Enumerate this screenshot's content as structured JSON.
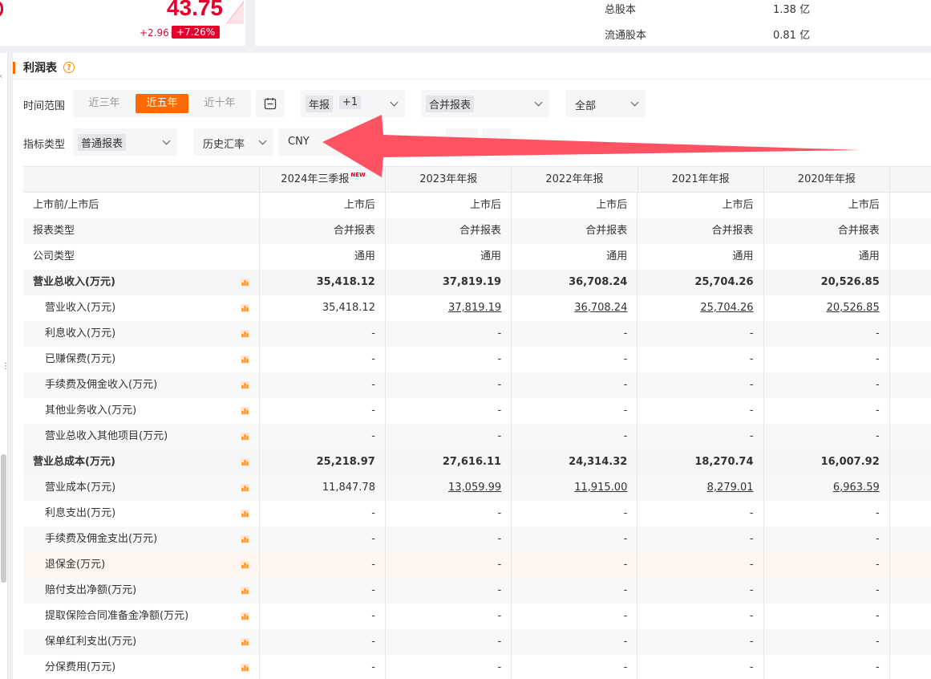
{
  "quote": {
    "price": "43.75",
    "change": "+2.96",
    "change_pct": "+7.26%",
    "stats": [
      {
        "label": "总股本",
        "value": "1.38 亿"
      },
      {
        "label": "流通股本",
        "value": "0.81 亿"
      }
    ]
  },
  "section": {
    "title": "利润表",
    "help": "?"
  },
  "filters": {
    "time_range_label": "时间范围",
    "time_range_options": [
      "近三年",
      "近五年",
      "近十年"
    ],
    "time_range_selected": "近五年",
    "report_period": {
      "value": "年报",
      "extra": "+1"
    },
    "report_type": "合并报表",
    "scope": "全部",
    "indicator_type_label": "指标类型",
    "indicator_type": "普通报表",
    "exchange_rate": "历史汇率",
    "currency": "CNY"
  },
  "table": {
    "columns": [
      "2024年三季报",
      "2023年年报",
      "2022年年报",
      "2021年年报",
      "2020年年报"
    ],
    "new_badge": "NEW",
    "rows": [
      {
        "name": "上市前/上市后",
        "values": [
          "上市后",
          "上市后",
          "上市后",
          "上市后",
          "上市后"
        ]
      },
      {
        "name": "报表类型",
        "values": [
          "合并报表",
          "合并报表",
          "合并报表",
          "合并报表",
          "合并报表"
        ]
      },
      {
        "name": "公司类型",
        "values": [
          "通用",
          "通用",
          "通用",
          "通用",
          "通用"
        ]
      },
      {
        "name": "营业总收入(万元)",
        "values": [
          "35,418.12",
          "37,819.19",
          "36,708.24",
          "25,704.26",
          "20,526.85"
        ]
      },
      {
        "name": "营业收入(万元)",
        "values": [
          "35,418.12",
          "37,819.19",
          "36,708.24",
          "25,704.26",
          "20,526.85"
        ]
      },
      {
        "name": "利息收入(万元)",
        "values": [
          "-",
          "-",
          "-",
          "-",
          "-"
        ]
      },
      {
        "name": "已赚保费(万元)",
        "values": [
          "-",
          "-",
          "-",
          "-",
          "-"
        ]
      },
      {
        "name": "手续费及佣金收入(万元)",
        "values": [
          "-",
          "-",
          "-",
          "-",
          "-"
        ]
      },
      {
        "name": "其他业务收入(万元)",
        "values": [
          "-",
          "-",
          "-",
          "-",
          "-"
        ]
      },
      {
        "name": "营业总收入其他项目(万元)",
        "values": [
          "-",
          "-",
          "-",
          "-",
          "-"
        ]
      },
      {
        "name": "营业总成本(万元)",
        "values": [
          "25,218.97",
          "27,616.11",
          "24,314.32",
          "18,270.74",
          "16,007.92"
        ]
      },
      {
        "name": "营业成本(万元)",
        "values": [
          "11,847.78",
          "13,059.99",
          "11,915.00",
          "8,279.01",
          "6,963.59"
        ]
      },
      {
        "name": "利息支出(万元)",
        "values": [
          "-",
          "-",
          "-",
          "-",
          "-"
        ]
      },
      {
        "name": "手续费及佣金支出(万元)",
        "values": [
          "-",
          "-",
          "-",
          "-",
          "-"
        ]
      },
      {
        "name": "退保金(万元)",
        "values": [
          "-",
          "-",
          "-",
          "-",
          "-"
        ]
      },
      {
        "name": "赔付支出净额(万元)",
        "values": [
          "-",
          "-",
          "-",
          "-",
          "-"
        ]
      },
      {
        "name": "提取保险合同准备金净额(万元)",
        "values": [
          "-",
          "-",
          "-",
          "-",
          "-"
        ]
      },
      {
        "name": "保单红利支出(万元)",
        "values": [
          "-",
          "-",
          "-",
          "-",
          "-"
        ]
      },
      {
        "name": "分保费用(万元)",
        "values": [
          "-",
          "-",
          "-",
          "-",
          "-"
        ]
      }
    ]
  },
  "colors": {
    "accent": "#ff6a00",
    "up": "#e4002b",
    "arrow": "#ff4d5e"
  }
}
